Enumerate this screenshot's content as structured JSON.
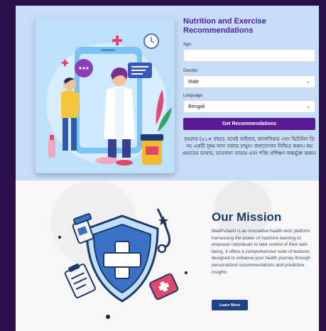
{
  "form": {
    "title": "Nutrition and Exercise Recommendations",
    "age_label": "Age:",
    "age_value": "",
    "gender_label": "Gender:",
    "gender_value": "Male",
    "language_label": "Language:",
    "language_value": "Bengali",
    "submit_label": "Get Recommendations"
  },
  "recommendation_text": "বৃদ্ধদের (৫১+ বছর): যথেষ্ট ফাইবার, ক্যালসিয়াম এবং ভিটামিন ডি সহ একটি সুষম খাদ্য বজায় রাখুন। জলযোগান নিশ্চিত করুন। কম প্রভাবের ব্যায়াম, ভারসাম্য ব্যায়াম এবং শক্তি প্রশিক্ষণ অন্তর্ভুক্ত করুন।",
  "mission": {
    "title": "Our Mission",
    "text": "MedPulseAI is an innovative health-tech platform harnessing the power of machine learning to empower individuals to take control of their well-being. It offers a comprehensive suite of features designed to enhance your health journey through personalized recommendations and predictive insights",
    "button_label": "Learn More"
  },
  "colors": {
    "brand_purple": "#5a1a96",
    "title_purple": "#4b1fa0",
    "mission_blue": "#1f3a6a",
    "button_blue": "#1f3f86",
    "page_bg": "#2b0f4a"
  },
  "icons": [
    "doctor-illustration",
    "phone-icon",
    "clock-icon",
    "chat-bubble-icon",
    "plus-icon",
    "shield-cross-icon",
    "stethoscope-icon",
    "pill-bottle-icon",
    "clipboard-icon",
    "medical-kit-icon"
  ]
}
